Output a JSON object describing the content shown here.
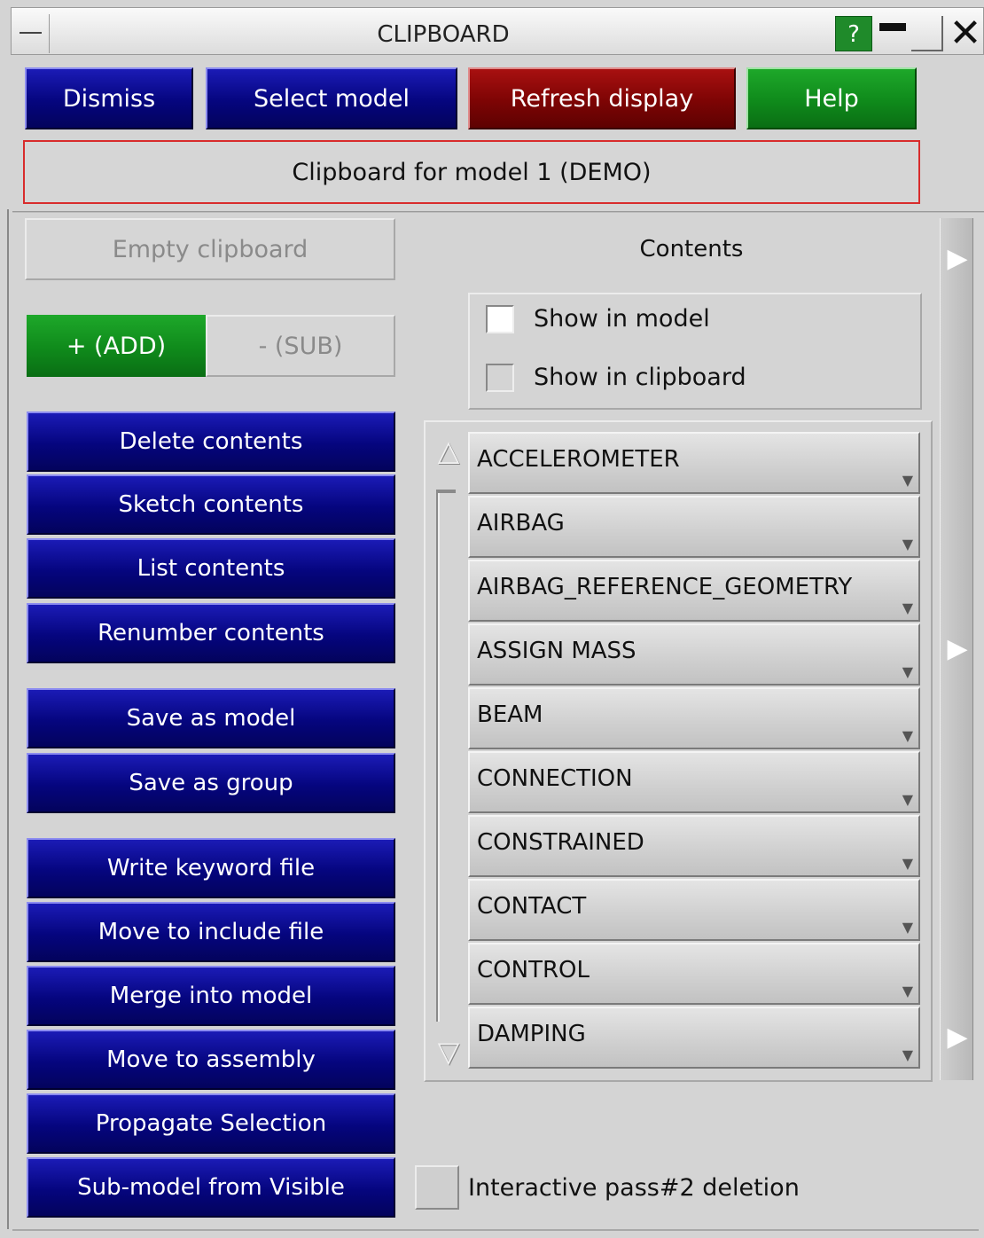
{
  "window": {
    "title": "CLIPBOARD",
    "help_glyph": "?",
    "close_glyph": "✕"
  },
  "top_buttons": {
    "dismiss": "Dismiss",
    "select_model": "Select model",
    "refresh_display": "Refresh display",
    "help": "Help"
  },
  "banner": "Clipboard for model 1 (DEMO)",
  "left": {
    "empty_clipboard": "Empty clipboard",
    "add": "+ (ADD)",
    "sub": "- (SUB)",
    "buttons": [
      "Delete contents",
      "Sketch contents",
      "List contents",
      "Renumber contents",
      "Save as model",
      "Save as group",
      "Write keyword file",
      "Move to include file",
      "Merge into model",
      "Move to assembly",
      "Propagate Selection",
      "Sub-model from Visible"
    ]
  },
  "right": {
    "contents_label": "Contents",
    "show_in_model": "Show in model",
    "show_in_clipboard": "Show in clipboard",
    "list_items": [
      "ACCELEROMETER",
      "AIRBAG",
      "AIRBAG_REFERENCE_GEOMETRY",
      "ASSIGN MASS",
      "BEAM",
      "CONNECTION",
      "CONSTRAINED",
      "CONTACT",
      "CONTROL",
      "DAMPING"
    ],
    "scroll_up_glyph": "△",
    "scroll_down_glyph": "▽",
    "item_arrow_glyph": "▼",
    "strip_arrow_glyph": "▶",
    "pass2_label": "Interactive pass#2 deletion"
  },
  "colors": {
    "blue_button": "#05057e",
    "red_button": "#7d0404",
    "green_button": "#0f8a1b",
    "panel": "#d4d4d4",
    "banner_border": "#d82c2c"
  },
  "icons": [
    "window-menu-icon",
    "help-icon",
    "minimize-icon",
    "restore-icon",
    "close-icon",
    "scroll-up-icon",
    "scroll-down-icon",
    "dropdown-arrow-icon",
    "expand-arrow-icon"
  ]
}
